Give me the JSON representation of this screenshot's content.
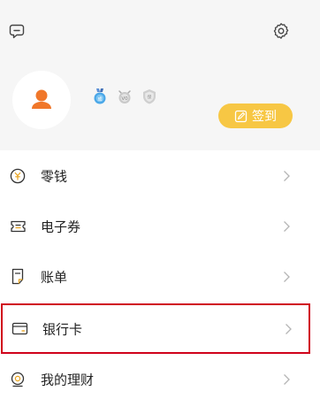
{
  "header": {
    "message_icon": "message-icon",
    "settings_icon": "gear-icon",
    "avatar_icon": "user-avatar-icon",
    "badges": [
      "growth-medal-badge",
      "vip-badge",
      "shield-badge"
    ],
    "signin_label": "签到",
    "signin_icon": "edit-check-icon"
  },
  "colors": {
    "header_bg": "#f6f6f6",
    "avatar": "#f0772a",
    "signin_bg": "#f7c744",
    "highlight_border": "#d0021b"
  },
  "menu": {
    "items": [
      {
        "label": "零钱",
        "icon": "yuan-coin-icon"
      },
      {
        "label": "电子券",
        "icon": "coupon-icon"
      },
      {
        "label": "账单",
        "icon": "bill-icon"
      },
      {
        "label": "银行卡",
        "icon": "bank-card-icon"
      },
      {
        "label": "我的理财",
        "icon": "finance-icon"
      }
    ]
  }
}
